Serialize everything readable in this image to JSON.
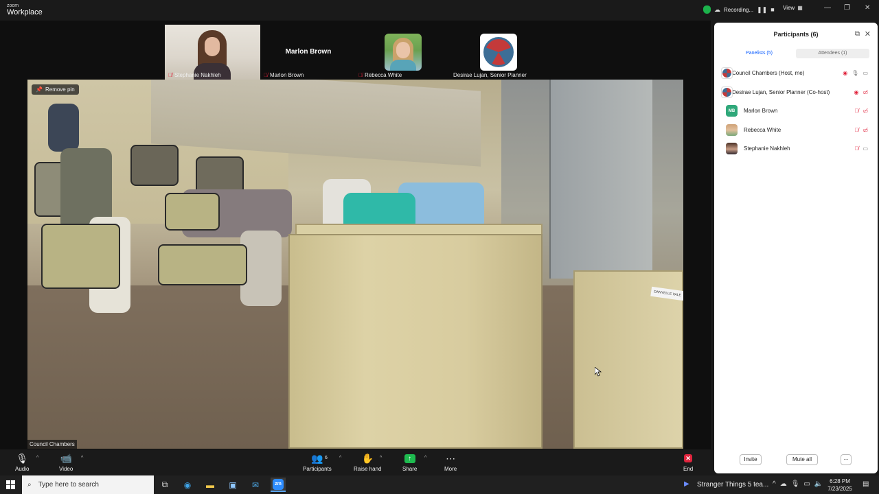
{
  "app": {
    "logo_small": "zoom",
    "logo_big": "Workplace",
    "recording_label": "Recording...",
    "view_label": "View",
    "colors": {
      "accent": "#0b5cff",
      "recording_shield": "#1cb34c",
      "muted_red": "#e0243d",
      "share_green": "#1ebb4f"
    }
  },
  "thumbnails": [
    {
      "name": "Stephanie Nakhleh",
      "muted": true
    },
    {
      "name": "Marlon Brown",
      "display_name": "Marlon Brown",
      "muted": true
    },
    {
      "name": "Rebecca White",
      "muted": true
    },
    {
      "name": "Desirae Lujan, Senior Planner",
      "muted": false
    }
  ],
  "pinned": {
    "remove_pin_label": "Remove pin",
    "name": "Council Chambers",
    "nameplate": "DANYELLE VALE"
  },
  "panel": {
    "title": "Participants (6)",
    "tabs": {
      "panelists": "Panelists (5)",
      "attendees": "Attendees (1)"
    },
    "participants": [
      {
        "name": "Council Chambers (Host, me)",
        "avatar": "logo"
      },
      {
        "name": "Desirae Lujan, Senior Planner (Co-host)",
        "avatar": "logo"
      },
      {
        "name": "Marlon Brown",
        "avatar": "MB"
      },
      {
        "name": "Rebecca White",
        "avatar": "photo"
      },
      {
        "name": "Stephanie Nakhleh",
        "avatar": "photo"
      }
    ],
    "invite_label": "Invite",
    "mute_all_label": "Mute all",
    "more_label": "..."
  },
  "toolbar": {
    "audio": "Audio",
    "video": "Video",
    "participants": "Participants",
    "participants_count": "6",
    "raise_hand": "Raise hand",
    "share": "Share",
    "more": "More",
    "end": "End"
  },
  "taskbar": {
    "search_placeholder": "Type here to search",
    "zoom_app_label": "zm",
    "notification_text": "Stranger Things 5 tea...",
    "time": "6:28 PM",
    "date": "7/23/2025"
  }
}
